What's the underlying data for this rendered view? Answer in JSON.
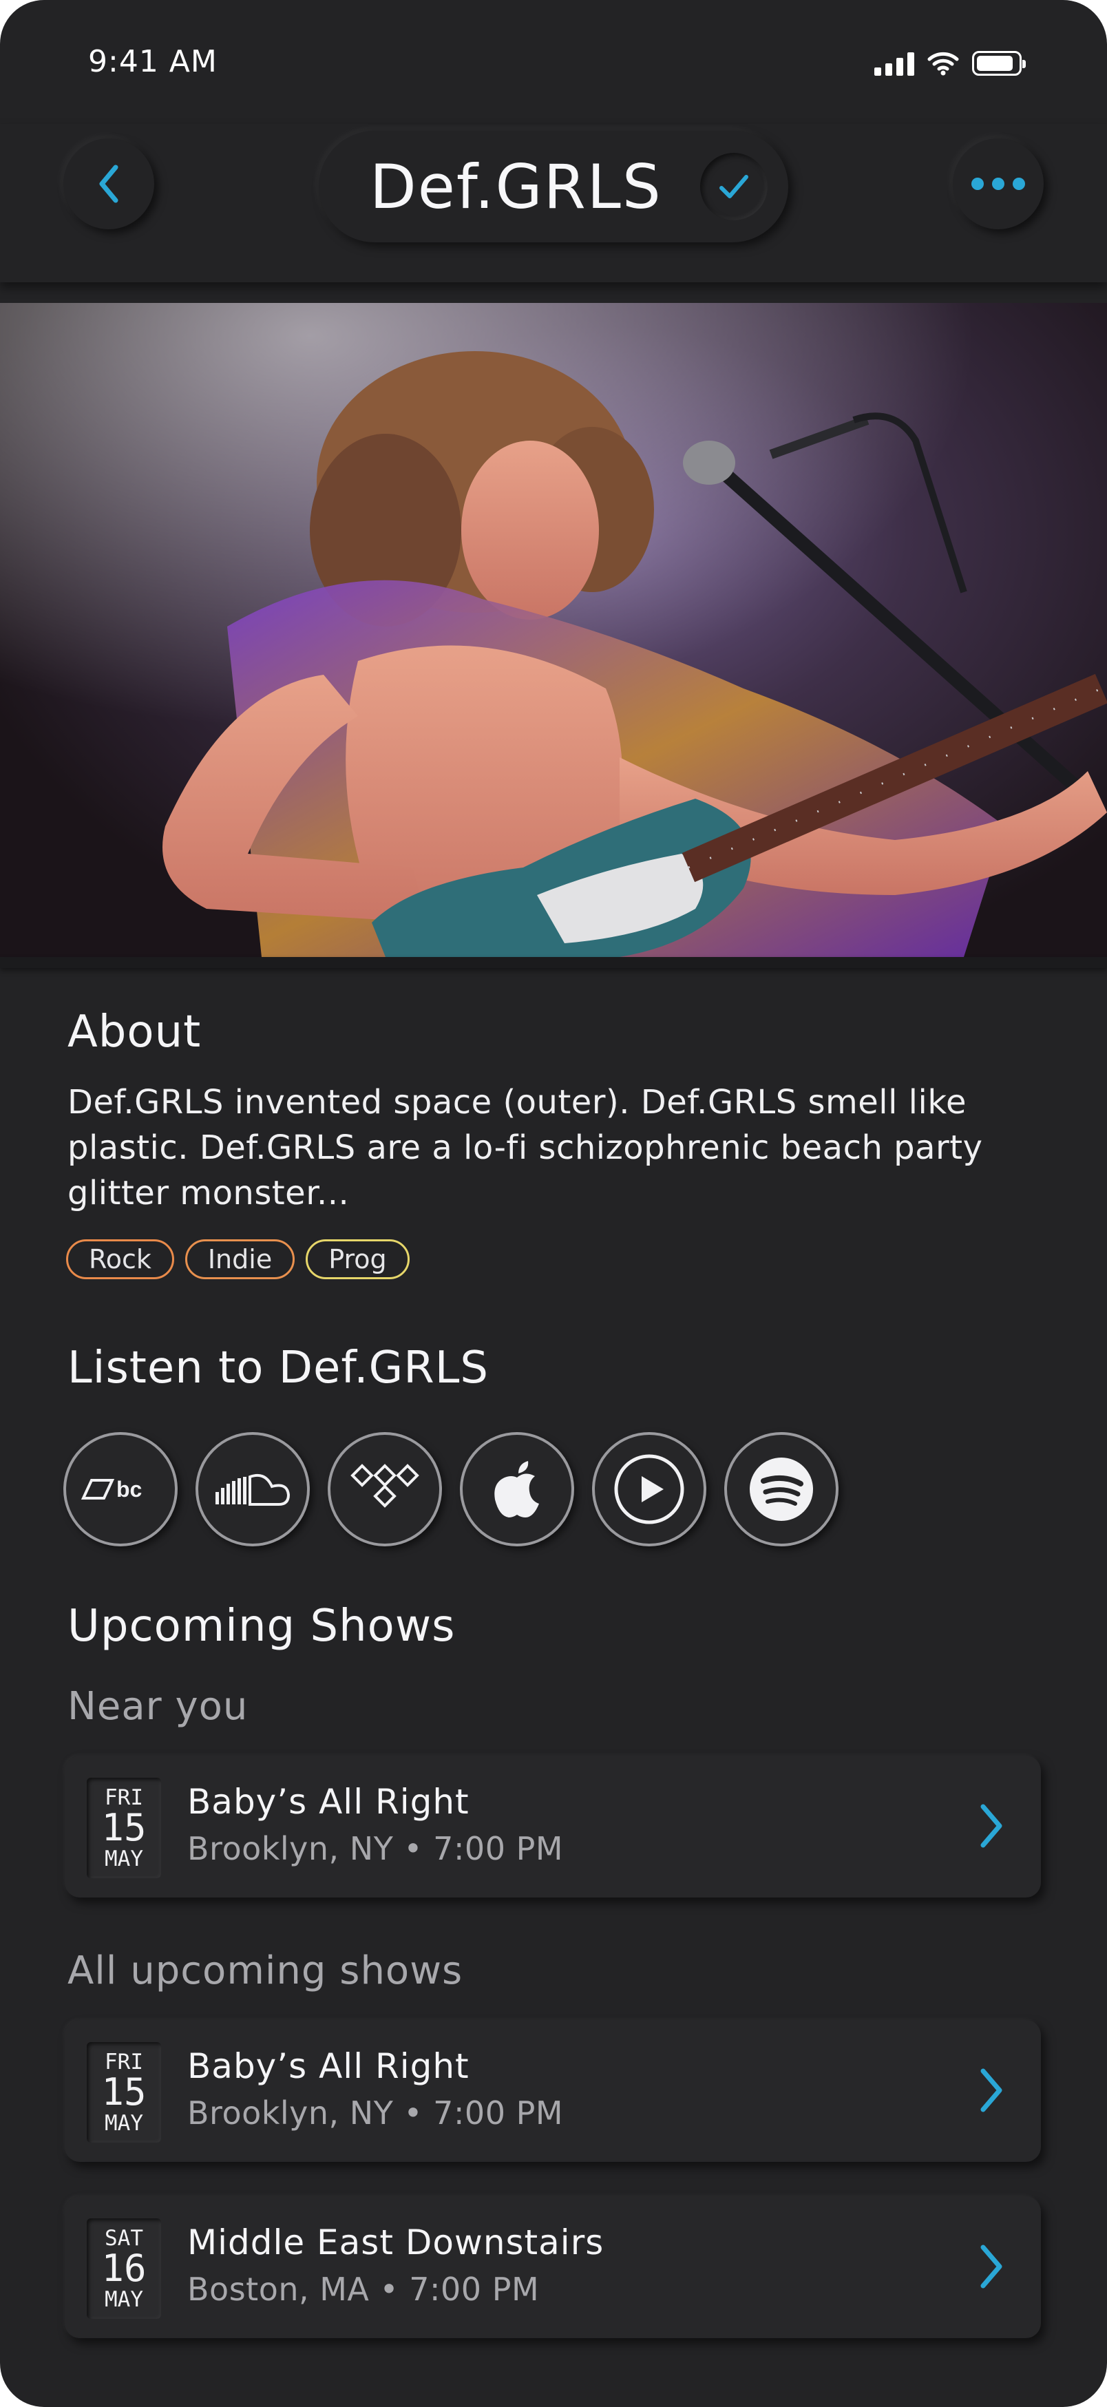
{
  "status_bar": {
    "time": "9:41 AM"
  },
  "nav": {
    "title": "Def.GRLS",
    "verified": true
  },
  "about": {
    "heading": "About",
    "text": "Def.GRLS invented space (outer). Def.GRLS smell like plastic. Def.GRLS are a lo-fi schizophrenic beach party glitter monster...",
    "tags": [
      {
        "label": "Rock",
        "color": "#e98a4a"
      },
      {
        "label": "Indie",
        "color": "#e8904e"
      },
      {
        "label": "Prog",
        "color": "#e6d66a"
      }
    ]
  },
  "listen": {
    "heading": "Listen to Def.GRLS",
    "services": [
      "bandcamp-icon",
      "soundcloud-icon",
      "tidal-icon",
      "apple-music-icon",
      "youtube-icon",
      "spotify-icon"
    ]
  },
  "shows": {
    "heading": "Upcoming Shows",
    "near_label": "Near you",
    "near": [
      {
        "dow": "FRI",
        "day": "15",
        "month": "MAY",
        "venue": "Baby’s All Right",
        "location": "Brooklyn, NY • 7:00 PM"
      }
    ],
    "all_label": "All upcoming shows",
    "all": [
      {
        "dow": "FRI",
        "day": "15",
        "month": "MAY",
        "venue": "Baby’s All Right",
        "location": "Brooklyn, NY • 7:00 PM"
      },
      {
        "dow": "SAT",
        "day": "16",
        "month": "MAY",
        "venue": "Middle East Downstairs",
        "location": "Boston, MA • 7:00 PM"
      }
    ]
  },
  "colors": {
    "accent": "#2aa7d6",
    "background": "#232325"
  }
}
